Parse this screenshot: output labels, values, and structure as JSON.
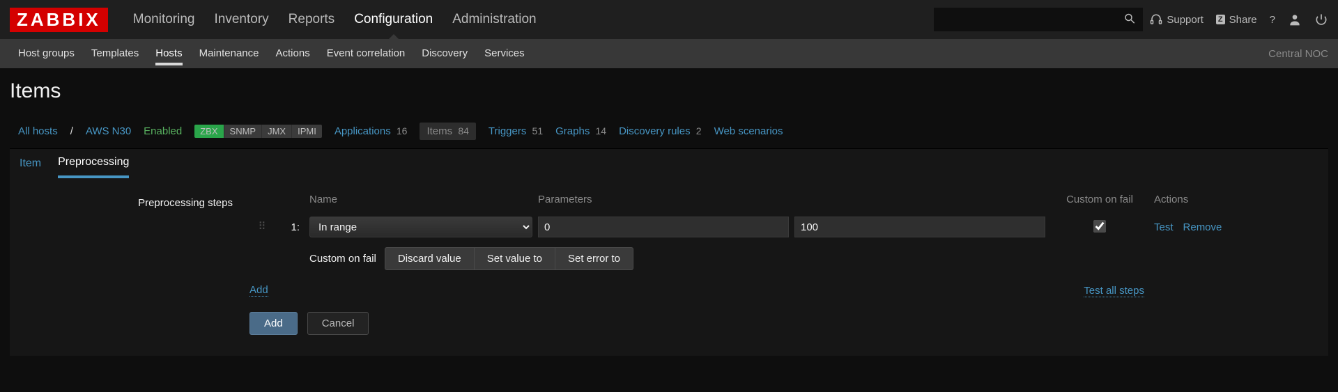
{
  "brand": "ZABBIX",
  "mainnav": {
    "monitoring": "Monitoring",
    "inventory": "Inventory",
    "reports": "Reports",
    "configuration": "Configuration",
    "administration": "Administration"
  },
  "top_right": {
    "support": "Support",
    "share": "Share",
    "share_badge": "Z",
    "help": "?"
  },
  "search": {
    "placeholder": ""
  },
  "subnav": {
    "host_groups": "Host groups",
    "templates": "Templates",
    "hosts": "Hosts",
    "maintenance": "Maintenance",
    "actions": "Actions",
    "event_correlation": "Event correlation",
    "discovery": "Discovery",
    "services": "Services",
    "right_label": "Central NOC"
  },
  "page_title": "Items",
  "hostbar": {
    "all_hosts": "All hosts",
    "sep": "/",
    "host_name": "AWS N30",
    "enabled": "Enabled",
    "tag_zbx": "ZBX",
    "tag_snmp": "SNMP",
    "tag_jmx": "JMX",
    "tag_ipmi": "IPMI",
    "applications": "Applications",
    "applications_cnt": "16",
    "items": "Items",
    "items_cnt": "84",
    "triggers": "Triggers",
    "triggers_cnt": "51",
    "graphs": "Graphs",
    "graphs_cnt": "14",
    "discovery": "Discovery rules",
    "discovery_cnt": "2",
    "webscenarios": "Web scenarios"
  },
  "tabs": {
    "item": "Item",
    "preprocessing": "Preprocessing"
  },
  "form": {
    "steps_label": "Preprocessing steps",
    "col_name": "Name",
    "col_params": "Parameters",
    "col_cof": "Custom on fail",
    "col_actions": "Actions",
    "row1": {
      "num": "1:",
      "type": "In range",
      "param1": "0",
      "param2": "100",
      "cof_checked": true,
      "test": "Test",
      "remove": "Remove"
    },
    "cof_label": "Custom on fail",
    "cof_discard": "Discard value",
    "cof_setvalue": "Set value to",
    "cof_seterror": "Set error to",
    "add_link": "Add",
    "test_all": "Test all steps",
    "submit": "Add",
    "cancel": "Cancel"
  }
}
